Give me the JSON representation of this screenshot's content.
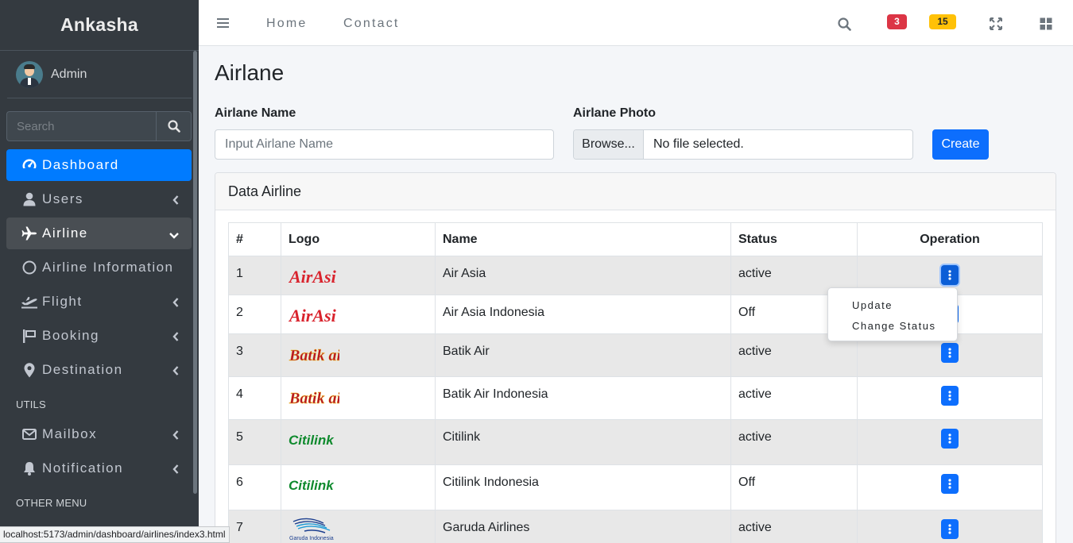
{
  "sidebar": {
    "brand": "Ankasha",
    "user_name": "Admin",
    "search_placeholder": "Search",
    "items": [
      {
        "label": "Dashboard",
        "icon": "tachometer-icon"
      },
      {
        "label": "Users",
        "icon": "user-icon"
      },
      {
        "label": "Airline",
        "icon": "plane-icon"
      },
      {
        "label": "Airline Information",
        "icon": "circle-icon"
      },
      {
        "label": "Flight",
        "icon": "plane-departure-icon"
      },
      {
        "label": "Booking",
        "icon": "flag-icon"
      },
      {
        "label": "Destination",
        "icon": "map-marker-icon"
      }
    ],
    "utils_header": "UTILS",
    "utils_items": [
      {
        "label": "Mailbox",
        "icon": "envelope-icon"
      },
      {
        "label": "Notification",
        "icon": "bell-icon"
      }
    ],
    "other_header": "OTHER MENU"
  },
  "navbar": {
    "home": "Home",
    "contact": "Contact",
    "badge_messages": "3",
    "badge_notifications": "15",
    "colors": {
      "danger": "#dc3545",
      "warning": "#ffc107"
    }
  },
  "main": {
    "title": "Airlane",
    "name_label": "Airlane Name",
    "name_placeholder": "Input Airlane Name",
    "photo_label": "Airlane Photo",
    "browse_label": "Browse...",
    "file_status": "No file selected.",
    "create_label": "Create",
    "card_title": "Data Airline"
  },
  "table": {
    "headers": [
      "#",
      "Logo",
      "Name",
      "Status",
      "Operation"
    ],
    "rows": [
      {
        "num": "1",
        "logo": "AirAsia",
        "name": "Air Asia",
        "status": "active"
      },
      {
        "num": "2",
        "logo": "AirAsia",
        "name": "Air Asia Indonesia",
        "status": "Off"
      },
      {
        "num": "3",
        "logo": "Batik air",
        "name": "Batik Air",
        "status": "active"
      },
      {
        "num": "4",
        "logo": "Batik air",
        "name": "Batik Air Indonesia",
        "status": "active"
      },
      {
        "num": "5",
        "logo": "Citilink",
        "name": "Citilink",
        "status": "active"
      },
      {
        "num": "6",
        "logo": "Citilink",
        "name": "Citilink Indonesia",
        "status": "Off"
      },
      {
        "num": "7",
        "logo": "Garuda Indonesia",
        "name": "Garuda Airlines",
        "status": "active"
      }
    ]
  },
  "dropdown": {
    "update": "Update",
    "change_status": "Change Status"
  },
  "statusbar": {
    "url": "localhost:5173/admin/dashboard/airlines/index3.html"
  }
}
